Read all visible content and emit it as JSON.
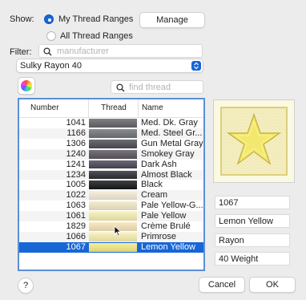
{
  "show": {
    "label": "Show:",
    "options": [
      "My Thread Ranges",
      "All Thread Ranges"
    ],
    "selected": 0,
    "manage_button": "Manage"
  },
  "filter": {
    "label": "Filter:",
    "placeholder": "manufacturer",
    "selected_range": "Sulky Rayon 40"
  },
  "search": {
    "placeholder": "find thread"
  },
  "table": {
    "headers": [
      "Number",
      "Thread",
      "Name"
    ],
    "rows": [
      {
        "number": "1041",
        "color": "#646568",
        "name": "Med. Dk. Gray"
      },
      {
        "number": "1166",
        "color": "#6f7378",
        "name": "Med. Steel Gr..."
      },
      {
        "number": "1306",
        "color": "#4d4e55",
        "name": "Gun Metal Gray"
      },
      {
        "number": "1240",
        "color": "#5a5661",
        "name": "Smokey Gray"
      },
      {
        "number": "1241",
        "color": "#4b4657",
        "name": "Dark Ash"
      },
      {
        "number": "1234",
        "color": "#2c2d33",
        "name": "Almost Black"
      },
      {
        "number": "1005",
        "color": "#161718",
        "name": "Black"
      },
      {
        "number": "1022",
        "color": "#f3ecd5",
        "name": "Cream"
      },
      {
        "number": "1063",
        "color": "#f2e8c6",
        "name": "Pale Yellow-G..."
      },
      {
        "number": "1061",
        "color": "#f6eeb2",
        "name": "Pale Yellow"
      },
      {
        "number": "1829",
        "color": "#f5e4b7",
        "name": "Crème Brulé"
      },
      {
        "number": "1066",
        "color": "#f7efaf",
        "name": "Primrose"
      },
      {
        "number": "1067",
        "color": "#f4ea86",
        "name": "Lemon Yellow"
      }
    ],
    "selected_index": 12
  },
  "details": {
    "number": "1067",
    "name": "Lemon Yellow",
    "type": "Rayon",
    "weight": "40 Weight",
    "preview_color": "#f3ee9a"
  },
  "buttons": {
    "help": "?",
    "cancel": "Cancel",
    "ok": "OK"
  },
  "colors": {
    "accent": "#1766d6",
    "table_border": "#5b8fd6"
  }
}
